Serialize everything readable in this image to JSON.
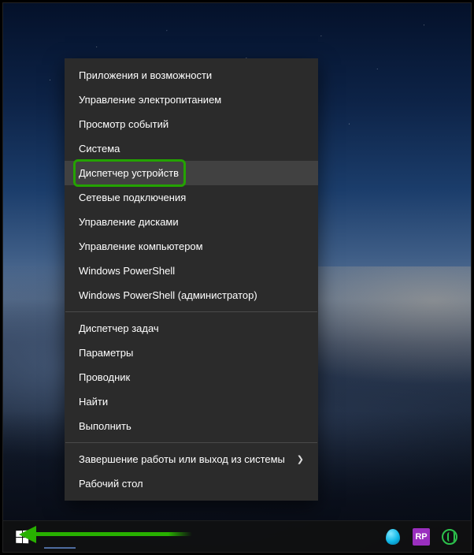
{
  "menu": {
    "highlighted_index": 4,
    "groups": [
      [
        {
          "label": "Приложения и возможности",
          "has_submenu": false
        },
        {
          "label": "Управление электропитанием",
          "has_submenu": false
        },
        {
          "label": "Просмотр событий",
          "has_submenu": false
        },
        {
          "label": "Система",
          "has_submenu": false
        },
        {
          "label": "Диспетчер устройств",
          "has_submenu": false
        },
        {
          "label": "Сетевые подключения",
          "has_submenu": false
        },
        {
          "label": "Управление дисками",
          "has_submenu": false
        },
        {
          "label": "Управление компьютером",
          "has_submenu": false
        },
        {
          "label": "Windows PowerShell",
          "has_submenu": false
        },
        {
          "label": "Windows PowerShell (администратор)",
          "has_submenu": false
        }
      ],
      [
        {
          "label": "Диспетчер задач",
          "has_submenu": false
        },
        {
          "label": "Параметры",
          "has_submenu": false
        },
        {
          "label": "Проводник",
          "has_submenu": false
        },
        {
          "label": "Найти",
          "has_submenu": false
        },
        {
          "label": "Выполнить",
          "has_submenu": false
        }
      ],
      [
        {
          "label": "Завершение работы или выход из системы",
          "has_submenu": true
        },
        {
          "label": "Рабочий стол",
          "has_submenu": false
        }
      ]
    ]
  },
  "taskbar": {
    "tray": {
      "rp_label": "RP"
    }
  },
  "colors": {
    "menu_bg": "#2b2b2b",
    "menu_hover": "#414141",
    "accent_green": "#24a200",
    "arrow_green": "#28b000"
  }
}
